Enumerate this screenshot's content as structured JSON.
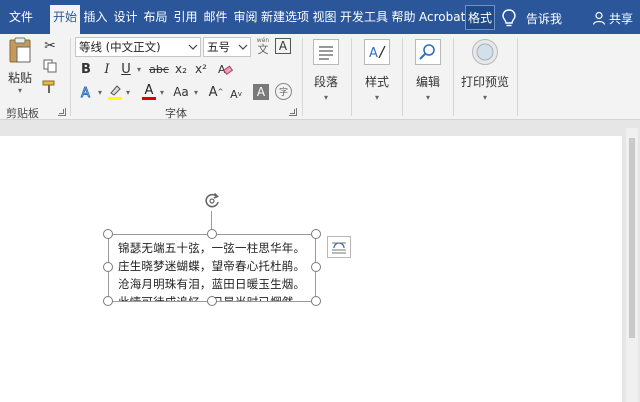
{
  "tabs": {
    "file": "文件",
    "home": "开始",
    "insert": "插入",
    "design": "设计",
    "layout": "布局",
    "references": "引用",
    "mailings": "邮件",
    "review": "审阅",
    "new_tab": "新建选项",
    "view": "视图",
    "developer": "开发工具",
    "help": "帮助",
    "acrobat": "Acrobat",
    "format": "格式"
  },
  "tell_me": "告诉我",
  "share": "共享",
  "clipboard": {
    "paste_label": "粘贴",
    "group_label": "剪贴板"
  },
  "font": {
    "font_name": "等线 (中文正文)",
    "font_size": "五号",
    "group_label": "字体",
    "bold": "B",
    "italic": "I",
    "underline": "U",
    "strikethrough": "abc",
    "subscript": "x₂",
    "superscript": "x²",
    "grow": "A",
    "shrink": "A",
    "change_case": "Aa",
    "char_shading": "A",
    "wen": "文"
  },
  "paragraph": {
    "label": "段落"
  },
  "styles": {
    "label": "样式"
  },
  "editing": {
    "label": "编辑"
  },
  "print_preview": {
    "label": "打印预览"
  },
  "colors": {
    "title_bar": "#2b579a",
    "ribbon_bg": "#f3f3f3",
    "highlight": "#ffff00",
    "font_color": "#e00000",
    "accent_blue": "#2b579a"
  },
  "document": {
    "poem_lines": [
      "锦瑟无端五十弦，一弦一柱思华年。",
      "庄生晓梦迷蝴蝶，望帝春心托杜鹃。",
      "沧海月明珠有泪，蓝田日暖玉生烟。",
      "此情可待成追忆，只是当时已惘然。"
    ]
  }
}
